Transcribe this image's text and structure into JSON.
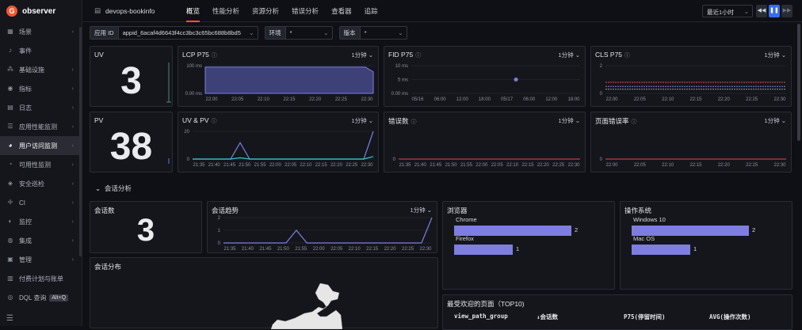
{
  "app": {
    "logo": "observer"
  },
  "sidebar": {
    "items": [
      {
        "label": "场景",
        "icon": "scene-icon",
        "arrow": true
      },
      {
        "label": "事件",
        "icon": "bell-icon",
        "arrow": false
      },
      {
        "label": "基础设施",
        "icon": "infra-icon",
        "arrow": true
      },
      {
        "label": "指标",
        "icon": "metric-icon",
        "arrow": true
      },
      {
        "label": "日志",
        "icon": "log-icon",
        "arrow": true
      },
      {
        "label": "应用性能监测",
        "icon": "apm-icon",
        "arrow": true
      },
      {
        "label": "用户访问监测",
        "icon": "rum-icon",
        "arrow": true,
        "active": true
      },
      {
        "label": "可用性监测",
        "icon": "dial-icon",
        "arrow": true
      },
      {
        "label": "安全巡检",
        "icon": "shield-icon",
        "arrow": true
      },
      {
        "label": "CI",
        "icon": "ci-icon",
        "arrow": true
      },
      {
        "label": "监控",
        "icon": "monitor-icon",
        "arrow": true
      },
      {
        "label": "集成",
        "icon": "integration-icon",
        "arrow": true
      },
      {
        "label": "管理",
        "icon": "gear-icon",
        "arrow": true
      },
      {
        "label": "付费计划与账单",
        "icon": "billing-icon",
        "arrow": false
      },
      {
        "label": "DQL 查询",
        "icon": "search-icon",
        "arrow": false,
        "kbd": "Alt+Q"
      }
    ]
  },
  "topbar": {
    "app_name": "devops-bookinfo",
    "tabs": [
      "概览",
      "性能分析",
      "资源分析",
      "错误分析",
      "查看器",
      "追踪"
    ],
    "active_tab": 0,
    "time_range": "最近1小时"
  },
  "filters": [
    {
      "label": "应用 ID",
      "value": "appid_6acaf4d6643f4cc3bc3c65bc688b8bd5"
    },
    {
      "label": "环境",
      "value": "*"
    },
    {
      "label": "版本",
      "value": "*"
    }
  ],
  "cards": {
    "uv": {
      "title": "UV",
      "value": "3"
    },
    "pv": {
      "title": "PV",
      "value": "38"
    },
    "lcp": {
      "title": "LCP P75",
      "gran": "1分钟"
    },
    "fid": {
      "title": "FID P75",
      "gran": "1分钟"
    },
    "cls": {
      "title": "CLS P75",
      "gran": "1分钟"
    },
    "uvpv": {
      "title": "UV & PV",
      "gran": "1分钟"
    },
    "errors": {
      "title": "错误数",
      "gran": "1分钟"
    },
    "err_rate": {
      "title": "页面错误率",
      "gran": "1分钟"
    },
    "session_count": {
      "title": "会话数",
      "value": "3"
    },
    "session_trend": {
      "title": "会话趋势",
      "gran": "1分钟"
    },
    "browsers": {
      "title": "浏览器"
    },
    "os": {
      "title": "操作系统"
    },
    "session_dist": {
      "title": "会话分布"
    },
    "top_pages": {
      "title": "最受欢迎的页面（TOP10)",
      "columns": [
        "view_path_group",
        "↓会话数",
        "P75(停留时间)",
        "AVG(操作次数)"
      ]
    }
  },
  "section": {
    "label": "会话分析"
  },
  "colors": {
    "accent": "#f0582c",
    "bar": "#7e7ee0",
    "line": "#7b7fe0",
    "teal": "#3fc1c9",
    "red": "#e8474a"
  },
  "chart_data": [
    {
      "type": "area",
      "title": "LCP P75",
      "x": [
        "22:00",
        "22:05",
        "22:10",
        "22:15",
        "22:20",
        "22:25",
        "22:30"
      ],
      "yticks": [
        "100 ms",
        "0.00 ms"
      ],
      "series": [
        {
          "values": [
            95,
            95,
            95,
            95,
            95,
            95,
            95
          ]
        }
      ]
    },
    {
      "type": "scatter",
      "title": "FID P75",
      "x": [
        "05/16",
        "06:00",
        "12:00",
        "18:00",
        "05/17",
        "06:00",
        "12:00",
        "18:00"
      ],
      "yticks": [
        "10 ms",
        "5 ms",
        "0.00 ms"
      ],
      "series": [
        {
          "values": [
            5
          ]
        }
      ]
    },
    {
      "type": "line",
      "title": "CLS P75",
      "x": [
        "22:00",
        "22:05",
        "22:10",
        "22:15",
        "22:20",
        "22:25",
        "22:30"
      ],
      "yticks": [
        "2",
        "0"
      ],
      "series": [
        {
          "values": [
            0.8,
            0.8,
            0.8,
            0.8,
            0.8,
            0.8,
            0.8
          ]
        },
        {
          "values": [
            0.5,
            0.5,
            0.5,
            0.5,
            0.5,
            0.5,
            0.5
          ]
        },
        {
          "values": [
            0.3,
            0.3,
            0.3,
            0.3,
            0.3,
            0.3,
            0.3
          ]
        }
      ]
    },
    {
      "type": "line",
      "title": "UV & PV",
      "x": [
        "21:35",
        "21:40",
        "21:45",
        "21:50",
        "21:55",
        "22:00",
        "22:05",
        "22:10",
        "22:15",
        "22:20",
        "22:25",
        "22:30"
      ],
      "yticks": [
        "20",
        "0"
      ],
      "series": [
        {
          "values": [
            0,
            0,
            0,
            0,
            0,
            13,
            0,
            0,
            0,
            0,
            0,
            0,
            0,
            0,
            0,
            0,
            0,
            0,
            0,
            22
          ]
        },
        {
          "values": [
            0,
            0,
            0,
            0,
            0,
            1,
            0,
            0,
            0,
            0,
            0,
            0,
            0,
            0,
            0,
            0,
            0,
            0,
            0,
            2
          ]
        }
      ]
    },
    {
      "type": "line",
      "title": "错误数",
      "x": [
        "21:35",
        "21:40",
        "21:45",
        "21:50",
        "21:55",
        "22:00",
        "22:05",
        "22:10",
        "22:15",
        "22:20",
        "22:25",
        "22:30"
      ],
      "yticks": [
        "0"
      ],
      "series": [
        {
          "values": [
            0,
            0,
            0,
            0,
            0,
            0,
            0,
            0,
            0,
            0,
            0,
            0
          ]
        }
      ]
    },
    {
      "type": "line",
      "title": "页面错误率",
      "x": [
        "22:00",
        "22:05",
        "22:10",
        "22:15",
        "22:20",
        "22:25",
        "22:30"
      ],
      "yticks": [
        "0"
      ],
      "series": [
        {
          "values": [
            0,
            0,
            0,
            0,
            0,
            0,
            0
          ]
        }
      ]
    },
    {
      "type": "line",
      "title": "会话趋势",
      "x": [
        "21:35",
        "21:40",
        "21:45",
        "21:50",
        "21:55",
        "22:00",
        "22:05",
        "22:10",
        "22:15",
        "22:20",
        "22:25",
        "22:30"
      ],
      "yticks": [
        "2",
        "1",
        "0"
      ],
      "series": [
        {
          "values": [
            0,
            0,
            0,
            0,
            0,
            0,
            0,
            1,
            0,
            0,
            0,
            0,
            0,
            0,
            0,
            0,
            0,
            0,
            0,
            0,
            2
          ]
        }
      ]
    },
    {
      "type": "bar",
      "title": "浏览器",
      "categories": [
        "Chrome",
        "Firefox"
      ],
      "values": [
        2,
        1
      ]
    },
    {
      "type": "bar",
      "title": "操作系统",
      "categories": [
        "Windows 10",
        "Mac OS"
      ],
      "values": [
        2,
        1
      ]
    }
  ]
}
